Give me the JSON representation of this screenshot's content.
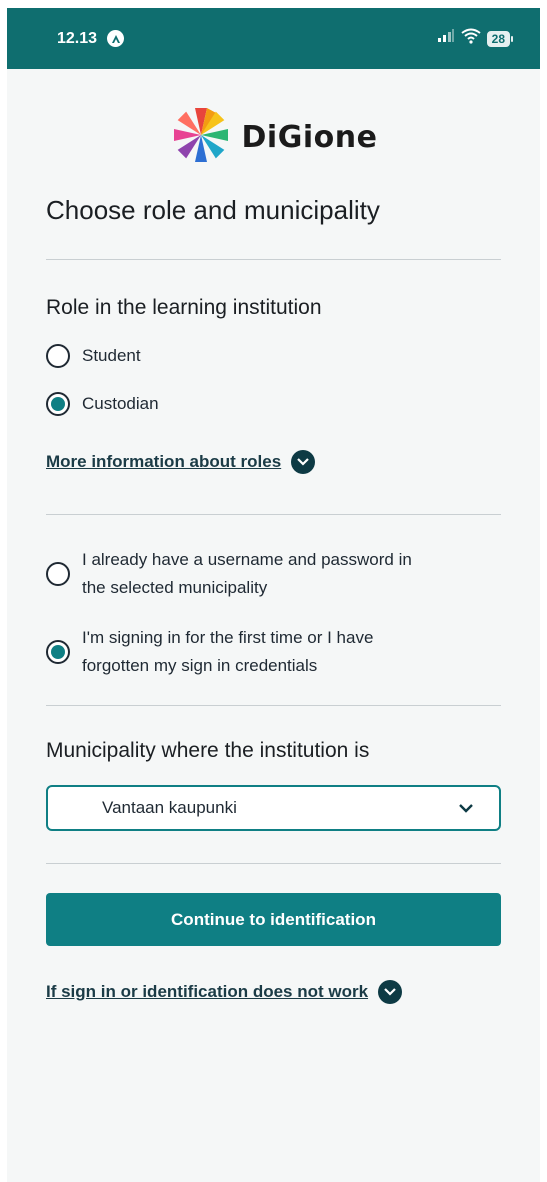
{
  "status": {
    "time": "12.13",
    "battery": "28"
  },
  "logo": {
    "text": "DiGione"
  },
  "page_title": "Choose role and municipality",
  "roles": {
    "heading": "Role in the learning institution",
    "options": [
      {
        "label": "Student",
        "checked": false
      },
      {
        "label": "Custodian",
        "checked": true
      }
    ],
    "more_info": "More information about roles"
  },
  "credentials": {
    "options": [
      {
        "label_line1": "I already have a username and password in",
        "label_line2": "the selected municipality",
        "checked": false
      },
      {
        "label_line1": "I'm signing in for the first time or I have",
        "label_line2": "forgotten my sign in credentials",
        "checked": true
      }
    ]
  },
  "municipality": {
    "heading": "Municipality where the institution is",
    "selected": "Vantaan kaupunki"
  },
  "continue_label": "Continue to identification",
  "help_link": "If sign in or identification does not work",
  "colors": {
    "brand": "#0f6e6f",
    "accent": "#0f7f84",
    "dark": "#0d3a44"
  }
}
